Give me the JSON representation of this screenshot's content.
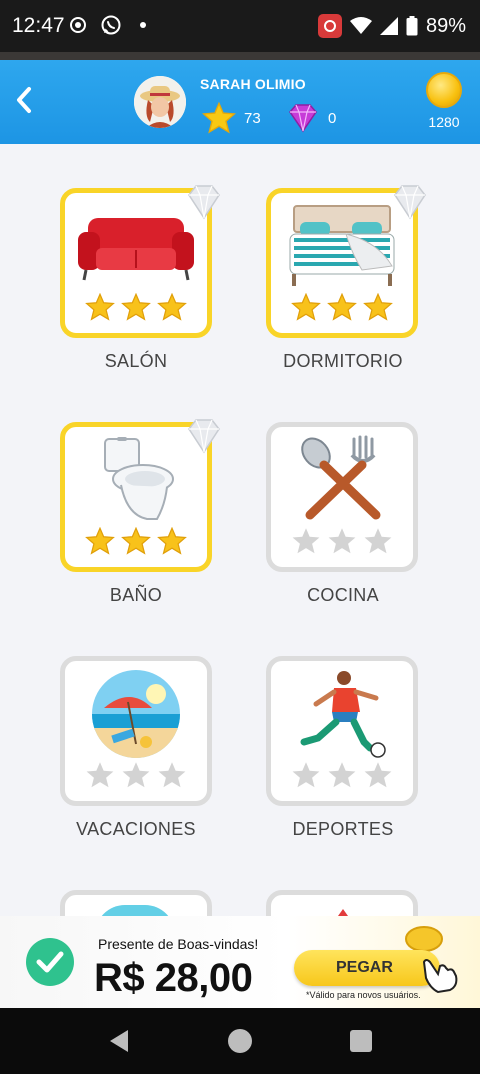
{
  "status_bar": {
    "time": "12:47",
    "battery": "89%",
    "left_icons": [
      "record-icon",
      "whatsapp-icon",
      "dot-icon"
    ],
    "right_icons": [
      "recording-icon",
      "wifi-icon",
      "signal-icon",
      "battery-icon"
    ]
  },
  "header": {
    "user_name": "SARAH OLIMIO",
    "stars": "73",
    "gems": "0",
    "coins": "1280",
    "accent": "#1d95e4"
  },
  "categories": [
    {
      "label": "SALÓN",
      "status": "completed",
      "stars": 3,
      "icon": "sofa-icon",
      "diamond": true
    },
    {
      "label": "DORMITORIO",
      "status": "completed",
      "stars": 3,
      "icon": "bed-icon",
      "diamond": true
    },
    {
      "label": "BAÑO",
      "status": "completed",
      "stars": 3,
      "icon": "toilet-icon",
      "diamond": true
    },
    {
      "label": "COCINA",
      "status": "locked",
      "stars": 0,
      "icon": "fork-spoon-icon",
      "diamond": false
    },
    {
      "label": "VACACIONES",
      "status": "locked",
      "stars": 0,
      "icon": "beach-icon",
      "diamond": false
    },
    {
      "label": "DEPORTES",
      "status": "locked",
      "stars": 0,
      "icon": "soccer-player-icon",
      "diamond": false
    }
  ],
  "ad": {
    "title": "Presente de Boas-vindas!",
    "price": "R$ 28,00",
    "button_label": "PEGAR",
    "note": "*Válido para novos usuários."
  },
  "colors": {
    "gold_border": "#f9d428",
    "locked_border": "#dcdcdc",
    "star_gold": "#f8c21a",
    "star_grey": "#cfcfcf"
  }
}
